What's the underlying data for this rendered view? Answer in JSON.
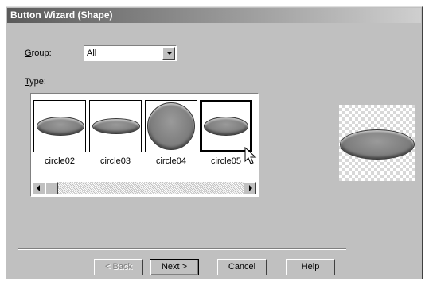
{
  "window": {
    "title": "Button Wizard (Shape)"
  },
  "group": {
    "label": "Group:",
    "value": "All"
  },
  "type": {
    "label": "Type:",
    "items": [
      {
        "caption": "circle02"
      },
      {
        "caption": "circle03"
      },
      {
        "caption": "circle04"
      },
      {
        "caption": "circle05"
      }
    ]
  },
  "buttons": {
    "back": "< Back",
    "next": "Next >",
    "cancel": "Cancel",
    "help": "Help"
  },
  "icons": {
    "dropdown": "chevron-down-icon",
    "scroll_left": "arrow-left-icon",
    "scroll_right": "arrow-right-icon",
    "cursor": "mouse-pointer-icon"
  }
}
